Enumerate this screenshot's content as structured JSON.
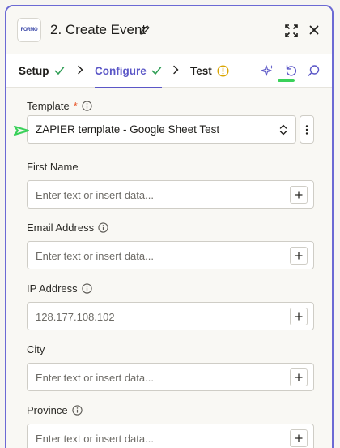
{
  "header": {
    "app_logo_text": "FORMO",
    "title": "2. Create Event"
  },
  "tabs": [
    {
      "label": "Setup",
      "status": "complete"
    },
    {
      "label": "Configure",
      "status": "complete"
    },
    {
      "label": "Test",
      "status": "warning"
    }
  ],
  "template_field": {
    "label": "Template",
    "required_marker": "*",
    "value": "ZAPIER template - Google Sheet Test"
  },
  "fields": [
    {
      "label": "First Name",
      "has_info": false,
      "value": "",
      "placeholder": "Enter text or insert data..."
    },
    {
      "label": "Email Address",
      "has_info": true,
      "value": "",
      "placeholder": "Enter text or insert data..."
    },
    {
      "label": "IP Address",
      "has_info": true,
      "value": "128.177.108.102",
      "placeholder": ""
    },
    {
      "label": "City",
      "has_info": false,
      "value": "",
      "placeholder": "Enter text or insert data..."
    },
    {
      "label": "Province",
      "has_info": true,
      "value": "",
      "placeholder": "Enter text or insert data..."
    }
  ],
  "colors": {
    "accent": "#5b57c7",
    "panel_border": "#6c6ad4",
    "success": "#2f9e55",
    "warning": "#d9a400",
    "required": "#e8572a",
    "annotation": "#3ad15a"
  },
  "icons": {
    "edit": "pencil-icon",
    "expand": "expand-icon",
    "close": "close-icon",
    "ai": "sparkle-icon",
    "undo": "undo-icon",
    "search": "search-icon",
    "info": "info-icon",
    "plus": "plus-icon",
    "caret": "select-caret-icon",
    "kebab": "kebab-icon"
  }
}
